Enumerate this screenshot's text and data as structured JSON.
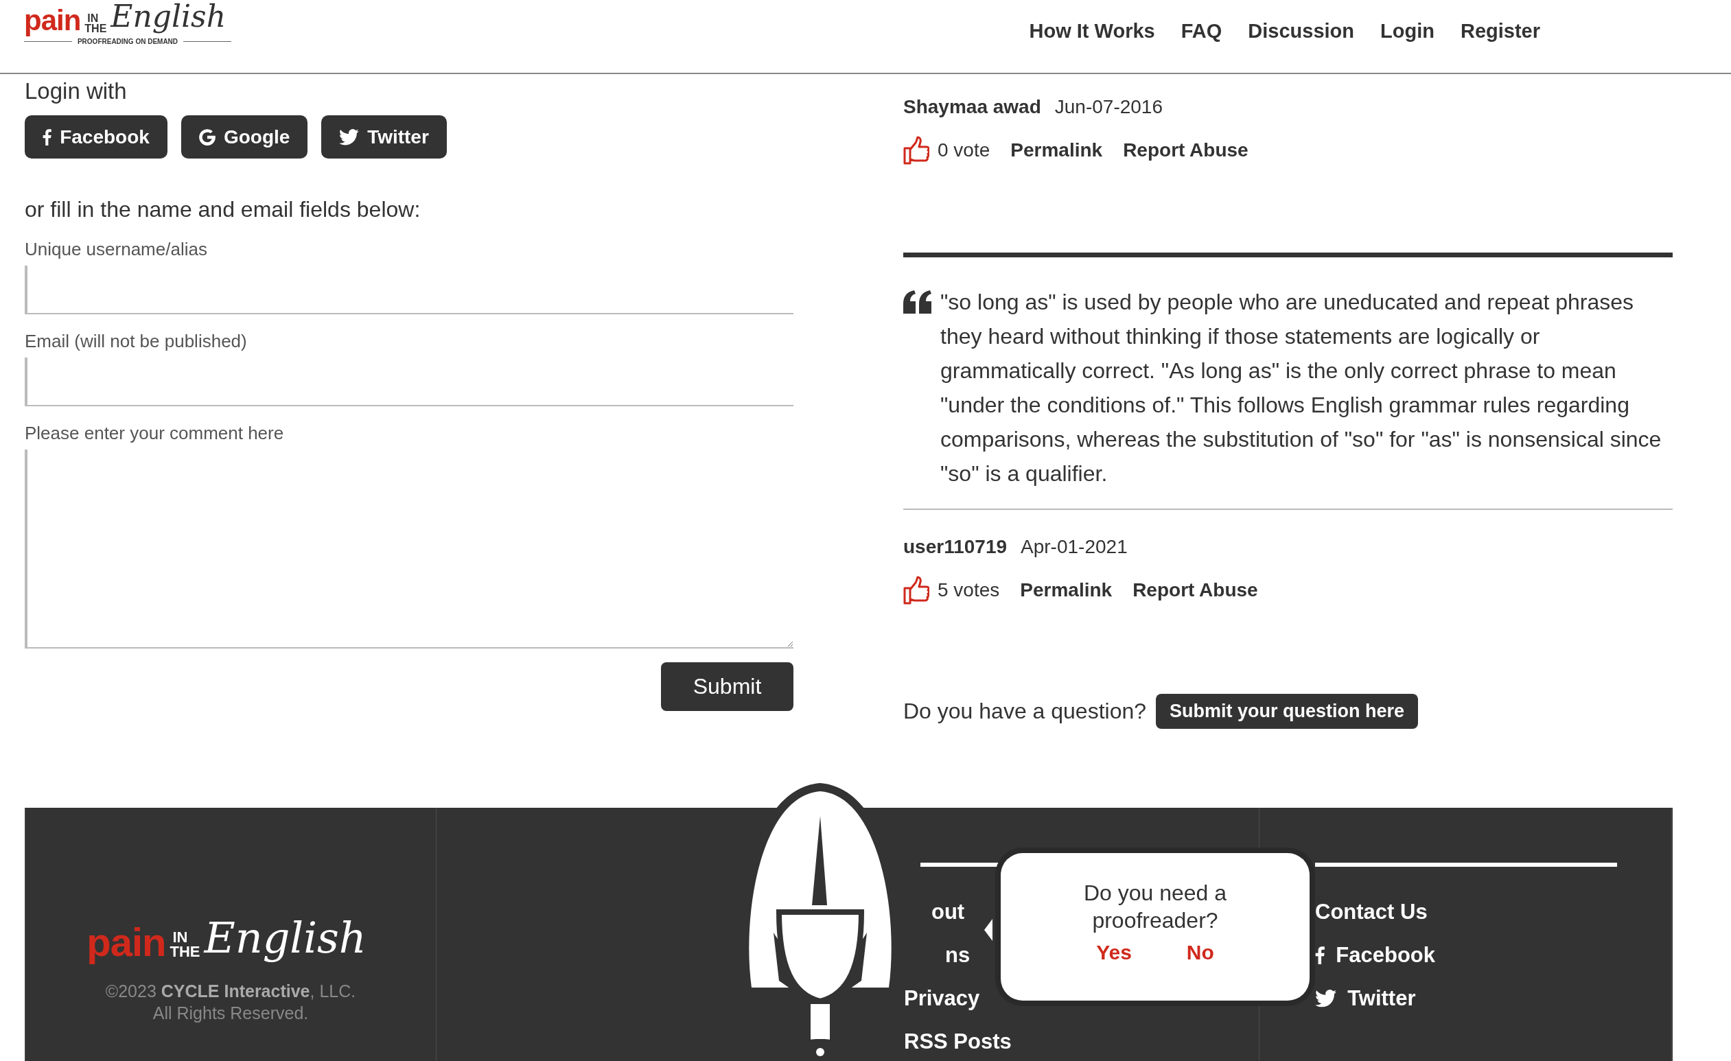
{
  "header": {
    "logo": {
      "word_1": "pain",
      "word_2": "IN",
      "word_3": "THE",
      "word_4": "English",
      "tagline": "PROOFREADING ON DEMAND"
    },
    "nav": [
      "How It Works",
      "FAQ",
      "Discussion",
      "Login",
      "Register"
    ]
  },
  "login": {
    "heading": "Login with",
    "providers": [
      {
        "kind": "facebook",
        "label": "Facebook"
      },
      {
        "kind": "google",
        "label": "Google"
      },
      {
        "kind": "twitter",
        "label": "Twitter"
      }
    ],
    "alternative": "or fill in the name and email fields below:",
    "fields": [
      {
        "kind": "input",
        "label": "Unique username/alias"
      },
      {
        "kind": "input",
        "label": "Email (will not be published)"
      },
      {
        "kind": "textarea",
        "label": "Please enter your comment here"
      }
    ],
    "submit": "Submit"
  },
  "answers": [
    {
      "author": "Shaymaa awad",
      "date": "Jun-07-2016",
      "votes": "0 vote",
      "actions": [
        "Permalink",
        "Report Abuse"
      ]
    },
    {
      "text": "\"so long as\" is used by people who are uneducated and repeat phrases they heard without thinking if those statements are logically or grammatically correct. \"As long as\" is the only correct phrase to mean \"under the conditions of.\" This follows English grammar rules regarding comparisons, whereas the substitution of \"so\" for \"as\" is nonsensical since \"so\" is a qualifier.",
      "author": "user110719",
      "date": "Apr-01-2021",
      "votes": "5 votes",
      "actions": [
        "Permalink",
        "Report Abuse"
      ]
    }
  ],
  "question": {
    "prompt": "Do you have a question?",
    "button": "Submit your question here"
  },
  "footer": {
    "logo": {
      "word_1": "pain",
      "word_2": "IN",
      "word_3": "THE",
      "word_4": "English"
    },
    "copyright": "©2023 **CYCLE Interactive**, LLC.",
    "rights": "All Rights Reserved.",
    "links": [
      "out",
      "ns",
      "Privacy",
      "RSS Posts"
    ],
    "social": [
      {
        "kind": "contact",
        "label": "Contact Us"
      },
      {
        "kind": "facebook",
        "label": "Facebook"
      },
      {
        "kind": "twitter",
        "label": "Twitter"
      }
    ]
  },
  "popup": {
    "question": "Do you need a proofreader?",
    "answers": [
      "Yes",
      "No"
    ]
  }
}
